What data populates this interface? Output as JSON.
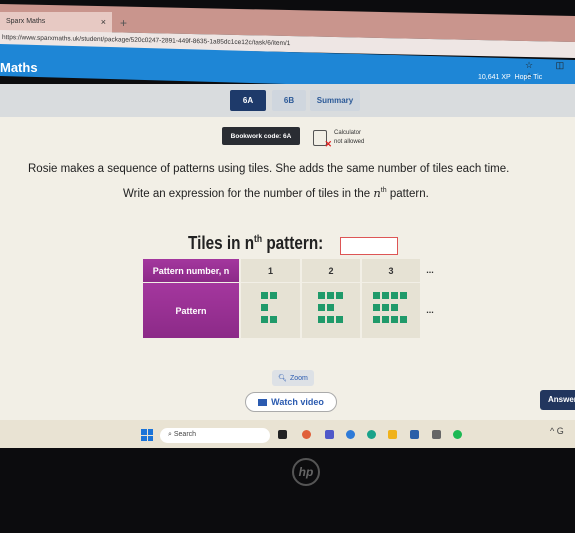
{
  "browser": {
    "tab_title": "Sparx Maths",
    "url": "https://www.sparxmaths.uk/student/package/520c0247-2891-449f-8635-1a85dc1ce12c/task/6/item/1"
  },
  "header": {
    "brand": "Maths",
    "xp": "10,641 XP",
    "user": "Hope Tic"
  },
  "nav": {
    "tabs": [
      "6A",
      "6B",
      "Summary"
    ],
    "active": "6A"
  },
  "question": {
    "bookwork": "Bookwork code: 6A",
    "calc_line1": "Calculator",
    "calc_line2": "not allowed",
    "line1": "Rosie makes a sequence of patterns using tiles. She adds the same number of tiles each time.",
    "line2_pre": "Write an expression for the number of tiles in the ",
    "line2_var": "n",
    "line2_sup": "th",
    "line2_post": " pattern.",
    "heading_pre": "Tiles in n",
    "heading_sup": "th",
    "heading_post": " pattern:"
  },
  "table": {
    "header_label": "Pattern number, n",
    "row_label": "Pattern",
    "columns": [
      "1",
      "2",
      "3"
    ],
    "ellipsis": "...",
    "tiles": [
      5,
      8,
      11
    ]
  },
  "buttons": {
    "zoom": "Zoom",
    "watch_video": "Watch video",
    "answer": "Answer"
  },
  "taskbar": {
    "search": "Search"
  },
  "colors": {
    "header_blue": "#1e86d6",
    "tile_green": "#1f9a6a",
    "purple": "#9a3194",
    "navy": "#1e3a6a"
  }
}
